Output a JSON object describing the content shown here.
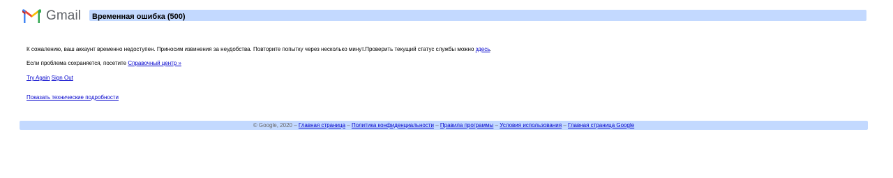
{
  "header": {
    "logo_text": "Gmail",
    "title": "Временная ошибка (500)"
  },
  "message": {
    "line1_text": "К сожалению, ваш аккаунт временно недоступен. Приносим извинения за неудобства. Повторите попытку через несколько минут.Проверить текущий статус службы можно ",
    "line1_link": "здесь",
    "line1_end": ".",
    "line2_text": "Если проблема сохраняется, посетите ",
    "line2_link": "Справочный центр »",
    "try_again": "Try Again",
    "sign_out": "Sign Out",
    "tech_details": "Показать технические подробности"
  },
  "footer": {
    "copyright": "© Google, 2020",
    "separator": " – ",
    "links": [
      "Главная страница",
      "Политика конфиденциальности",
      "Правила программы",
      "Условия использования",
      "Главная страница Google"
    ]
  },
  "colors": {
    "bar": "#c3d9ff",
    "link": "#0000cc",
    "footer_text": "#676767"
  }
}
